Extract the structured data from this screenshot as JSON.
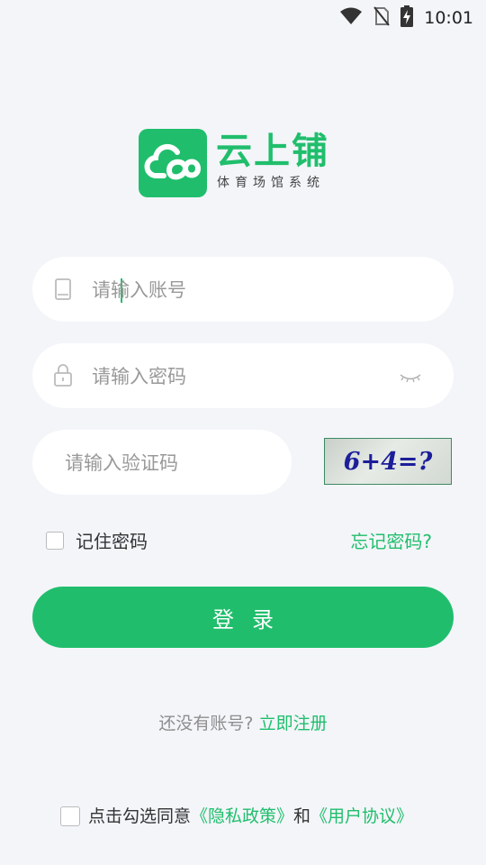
{
  "status_bar": {
    "time": "10:01"
  },
  "brand": {
    "name": "云上铺",
    "subtitle": "体育场馆系统"
  },
  "form": {
    "account_placeholder": "请输入账号",
    "password_placeholder": "请输入密码",
    "captcha_placeholder": "请输入验证码",
    "captcha_text": "6+4=?",
    "remember_label": "记住密码",
    "forgot_label": "忘记密码?",
    "login_label": "登录"
  },
  "register": {
    "prompt": "还没有账号?",
    "link": "立即注册"
  },
  "agreement": {
    "prefix": "点击勾选同意",
    "privacy_link": "《隐私政策》",
    "and": "和",
    "terms_link": "《用户协议》"
  },
  "colors": {
    "accent": "#20be6c",
    "background": "#f3f5f9"
  }
}
